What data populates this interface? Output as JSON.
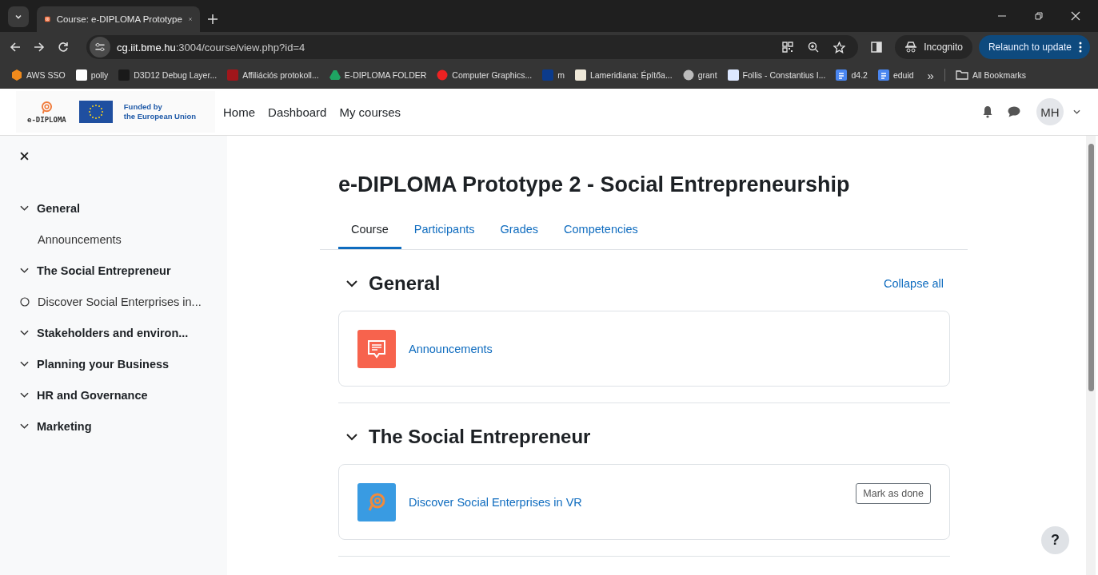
{
  "browser": {
    "tab_title": "Course: e-DIPLOMA Prototype",
    "url_host": "cg.iit.bme.hu",
    "url_path": ":3004/course/view.php?id=4",
    "profile_label": "Incognito",
    "update_button": "Relaunch to update",
    "bookmarks": [
      {
        "label": "AWS SSO",
        "kind": "cube"
      },
      {
        "label": "polly",
        "kind": "app"
      },
      {
        "label": "D3D12 Debug Layer...",
        "kind": "chip"
      },
      {
        "label": "Affiliációs protokoll...",
        "kind": "bars"
      },
      {
        "label": "E-DIPLOMA FOLDER",
        "kind": "drive"
      },
      {
        "label": "Computer Graphics...",
        "kind": "gear"
      },
      {
        "label": "m",
        "kind": "letter"
      },
      {
        "label": "Lameridiana: Építőa...",
        "kind": "eye"
      },
      {
        "label": "grant",
        "kind": "globe"
      },
      {
        "label": "Follis - Constantius I...",
        "kind": "script"
      },
      {
        "label": "d4.2",
        "kind": "doc"
      },
      {
        "label": "eduid",
        "kind": "doc"
      }
    ],
    "more_bookmarks": "»",
    "all_bookmarks": "All Bookmarks"
  },
  "header": {
    "logo_text": "e-DIPLOMA",
    "eu_text_line1": "Funded by",
    "eu_text_line2": "the European Union",
    "nav": [
      "Home",
      "Dashboard",
      "My courses"
    ],
    "avatar_initials": "MH"
  },
  "sidebar": {
    "items": [
      {
        "label": "General",
        "kind": "section",
        "expanded": true
      },
      {
        "label": "Announcements",
        "kind": "activity",
        "tracked": false
      },
      {
        "label": "The Social Entrepreneur",
        "kind": "section",
        "expanded": true
      },
      {
        "label": "Discover Social Enterprises in...",
        "kind": "activity",
        "tracked": true
      },
      {
        "label": "Stakeholders and environ...",
        "kind": "section",
        "expanded": true
      },
      {
        "label": "Planning your Business",
        "kind": "section",
        "expanded": true
      },
      {
        "label": "HR and Governance",
        "kind": "section",
        "expanded": true
      },
      {
        "label": "Marketing",
        "kind": "section",
        "expanded": true
      }
    ]
  },
  "course": {
    "title": "e-DIPLOMA Prototype 2 - Social Entrepreneurship",
    "tabs": [
      {
        "label": "Course",
        "selected": true
      },
      {
        "label": "Participants",
        "selected": false
      },
      {
        "label": "Grades",
        "selected": false
      },
      {
        "label": "Competencies",
        "selected": false
      }
    ],
    "collapse_all": "Collapse all",
    "sections": [
      {
        "title": "General",
        "expanded": true,
        "activities": [
          {
            "name": "Announcements",
            "kind": "forum"
          }
        ]
      },
      {
        "title": "The Social Entrepreneur",
        "expanded": true,
        "activities": [
          {
            "name": "Discover Social Enterprises in VR",
            "kind": "vr",
            "action": "Mark as done"
          }
        ]
      }
    ]
  },
  "help_button": "?"
}
